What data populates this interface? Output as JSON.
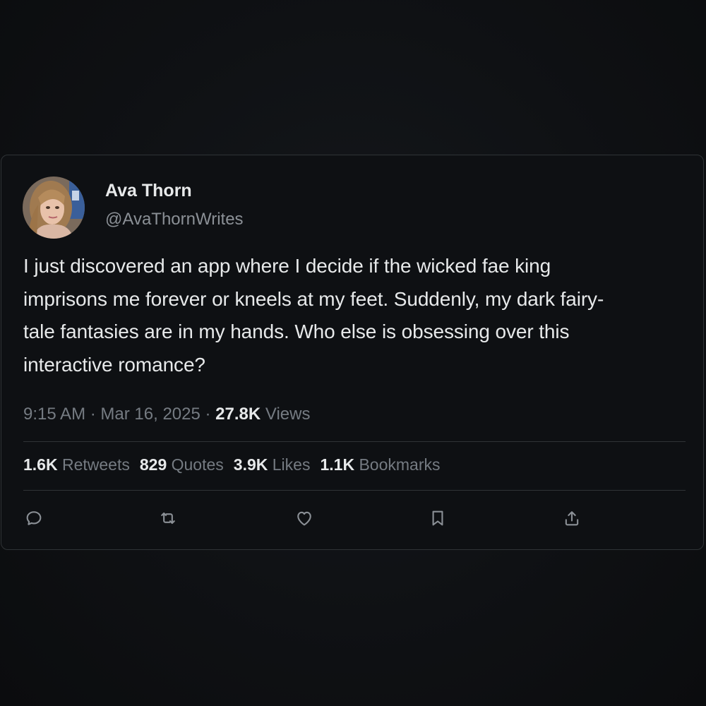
{
  "author": {
    "display_name": "Ava Thorn",
    "handle": "@AvaThornWrites",
    "avatar_icon": "profile-photo"
  },
  "tweet": {
    "lines": [
      "I just discovered an app where I decide if the wicked fae king",
      "imprisons me forever or kneels at my feet. Suddenly, my dark fairy-",
      "tale fantasies are in my hands. Who else is obsessing over this",
      "interactive romance?"
    ]
  },
  "meta": {
    "time": "9:15 AM",
    "dot1": "·",
    "date": "Mar 16, 2025",
    "dot2": "·",
    "views_count": "27.8K",
    "views_label": "Views"
  },
  "stats": {
    "retweets_count": "1.6K",
    "retweets_label": "Retweets",
    "quotes_count": "829",
    "quotes_label": "Quotes",
    "likes_count": "3.9K",
    "likes_label": "Likes",
    "bookmarks_count": "1.1K",
    "bookmarks_label": "Bookmarks"
  },
  "actions": [
    "reply-icon",
    "retweet-icon",
    "like-icon",
    "bookmark-icon",
    "share-icon"
  ],
  "colors": {
    "background": "#0e1013",
    "border": "#2f3336",
    "text_primary": "#e7e9ea",
    "text_secondary": "#757b82",
    "icon": "#8b9096"
  }
}
